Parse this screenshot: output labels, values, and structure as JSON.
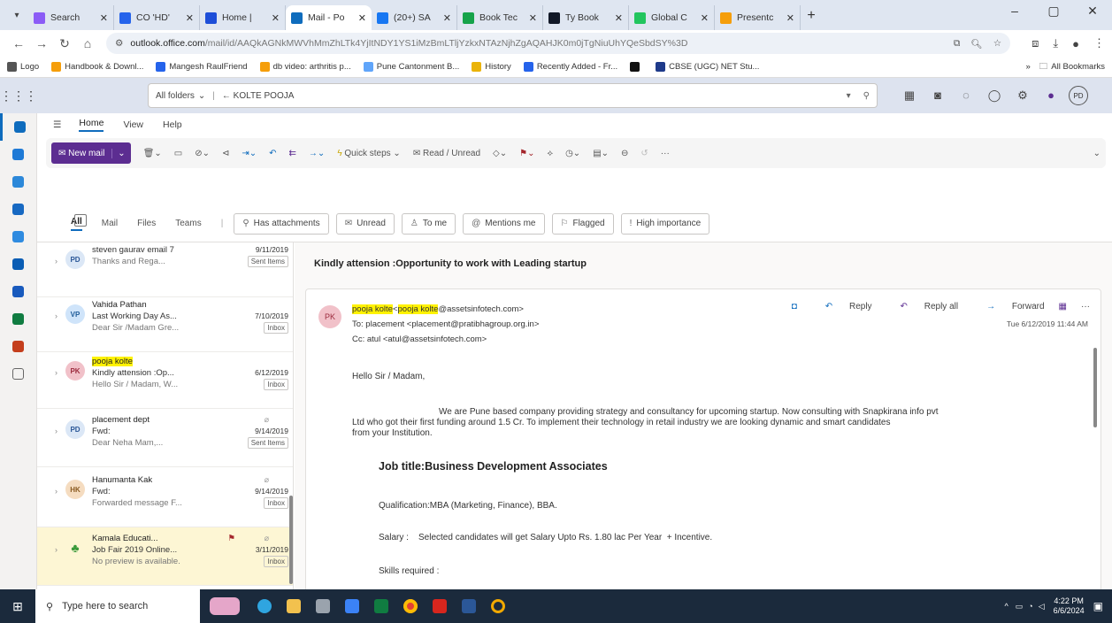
{
  "browser": {
    "tabs": [
      {
        "label": "Search",
        "color": "#8b5cf6"
      },
      {
        "label": "CO 'HD'",
        "color": "#2563eb"
      },
      {
        "label": "Home |",
        "color": "#1d4ed8"
      },
      {
        "label": "Mail - Po",
        "color": "#0f6cbd",
        "active": true
      },
      {
        "label": "(20+) SA",
        "color": "#1877f2"
      },
      {
        "label": "Book Tec",
        "color": "#16a34a"
      },
      {
        "label": "Ty Book",
        "color": "#111827"
      },
      {
        "label": "Global C",
        "color": "#22c55e"
      },
      {
        "label": "Presentc",
        "color": "#f59e0b"
      }
    ],
    "url_host": "outlook.office.com",
    "url_path": "/mail/id/AAQkAGNkMWVhMmZhLTk4YjItNDY1YS1iMzBmLTljYzkxNTAzNjhZgAQAHJK0m0jTgNiuUhYQeSbdSY%3D",
    "bookmarks": [
      {
        "label": "Logo",
        "color": "#555"
      },
      {
        "label": "Handbook & Downl...",
        "color": "#f59e0b"
      },
      {
        "label": "Mangesh RaulFriend",
        "color": "#2563eb"
      },
      {
        "label": "db video: arthritis p...",
        "color": "#f59e0b"
      },
      {
        "label": "Pune Cantonment B...",
        "color": "#60a5fa"
      },
      {
        "label": "History",
        "color": "#eab308"
      },
      {
        "label": "Recently Added - Fr...",
        "color": "#2563eb"
      },
      {
        "label": "",
        "color": "#111"
      },
      {
        "label": "CBSE (UGC) NET Stu...",
        "color": "#1e3a8a"
      }
    ],
    "all_bookmarks": "All Bookmarks"
  },
  "outlook": {
    "search_scope": "All folders",
    "search_text": "← KOLTE POOJA",
    "user_initials": "PD",
    "ribbon_tabs": [
      "Home",
      "View",
      "Help"
    ],
    "new_mail": "New mail",
    "ribbon": [
      "Quick steps",
      "Read / Unread"
    ],
    "filter_tabs": [
      "All",
      "Mail",
      "Files",
      "Teams"
    ],
    "chips": [
      "Has attachments",
      "Unread",
      "To me",
      "Mentions me",
      "Flagged",
      "High importance"
    ],
    "messages": [
      {
        "initials": "PD",
        "avbg": "#dbe7f6",
        "avfg": "#2b5797",
        "from": "",
        "subject": "steven gaurav email 7",
        "date": "9/11/2019",
        "preview": "Thanks and Rega...",
        "folder": "Sent Items"
      },
      {
        "initials": "VP",
        "avbg": "#cfe4fa",
        "avfg": "#1f5c99",
        "from": "Vahida Pathan",
        "subject": "Last Working Day As...",
        "date": "7/10/2019",
        "preview": "Dear Sir /Madam Gre...",
        "folder": "Inbox"
      },
      {
        "initials": "PK",
        "avbg": "#f1c1c9",
        "avfg": "#9c2b3e",
        "from": "pooja kolte",
        "subject": "Kindly attension :Op...",
        "date": "6/12/2019",
        "preview": "Hello Sir / Madam, W...",
        "folder": "Inbox"
      },
      {
        "initials": "PD",
        "avbg": "#dbe7f6",
        "avfg": "#2b5797",
        "from": "placement dept",
        "subject": "Fwd:",
        "date": "9/14/2019",
        "preview": "Dear Neha Mam,...",
        "folder": "Sent Items"
      },
      {
        "initials": "HK",
        "avbg": "#f5dcc0",
        "avfg": "#8a5a20",
        "from": "Hanumanta Kak",
        "subject": "Fwd:",
        "date": "9/14/2019",
        "preview": "Forwarded message F...",
        "folder": "Inbox"
      },
      {
        "initials": "",
        "avbg": "#3a9a3a",
        "avfg": "#fff",
        "from": "Kamala Educati...",
        "subject": "Job Fair 2019 Online...",
        "date": "3/11/2019",
        "preview": "No preview is available.",
        "folder": "Inbox"
      }
    ],
    "reading": {
      "subject": "Kindly attension :Opportunity to work with Leading startup",
      "sender_initials": "PK",
      "sender_name": "pooja kolte",
      "sender_name2": "pooja kolte",
      "sender_email": "@assetsinfotech.com>",
      "to": "To: placement <placement@pratibhagroup.org.in>",
      "cc": "Cc: atul <atul@assetsinfotech.com>",
      "reply": "Reply",
      "reply_all": "Reply all",
      "forward": "Forward",
      "datetime": "Tue 6/12/2019 11:44 AM",
      "greeting": "Hello Sir / Madam,",
      "para1": "We are Pune based company providing strategy and consultancy for upcoming startup. Now consulting with Snapkirana info pvt",
      "para2": "Ltd who got their first funding around 1.5 Cr. To implement their technology in retail industry we are looking dynamic and smart candidates",
      "para3": "from your Institution.",
      "job_title": "Job title:Business Development Associates",
      "qualification": "Qualification:MBA (Marketing, Finance), BBA.",
      "salary": "Salary :    Selected candidates will get Salary Upto Rs. 1.80 lac Per Year  + Incentive.",
      "skills": "Skills required :"
    }
  },
  "taskbar": {
    "search_placeholder": "Type here to search",
    "time": "4:22 PM",
    "date": "6/6/2024"
  }
}
